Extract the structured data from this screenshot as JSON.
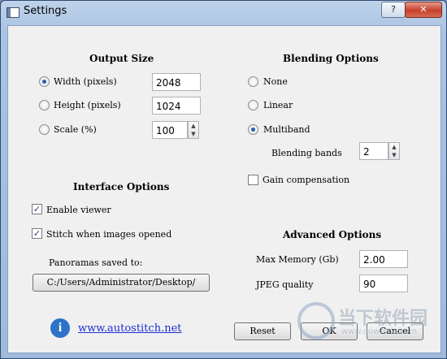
{
  "window": {
    "title": "Settings",
    "help_label": "?",
    "close_label": "✕"
  },
  "output_size": {
    "heading": "Output Size",
    "options": [
      {
        "label": "Width (pixels)",
        "value": "2048",
        "selected": true
      },
      {
        "label": "Height (pixels)",
        "value": "1024",
        "selected": false
      },
      {
        "label": "Scale (%)",
        "value": "100",
        "selected": false
      }
    ]
  },
  "blending": {
    "heading": "Blending Options",
    "options": [
      {
        "label": "None",
        "selected": false
      },
      {
        "label": "Linear",
        "selected": false
      },
      {
        "label": "Multiband",
        "selected": true
      }
    ],
    "bands_label": "Blending bands",
    "bands_value": "2",
    "gain_label": "Gain compensation",
    "gain_checked": false
  },
  "interface": {
    "heading": "Interface Options",
    "enable_viewer_label": "Enable viewer",
    "enable_viewer_checked": true,
    "stitch_label": "Stitch when images opened",
    "stitch_checked": true,
    "saved_to_label": "Panoramas saved to:",
    "path_button": "C:/Users/Administrator/Desktop/"
  },
  "advanced": {
    "heading": "Advanced Options",
    "memory_label": "Max Memory (Gb)",
    "memory_value": "2.00",
    "jpeg_label": "JPEG quality",
    "jpeg_value": "90"
  },
  "footer": {
    "link": "www.autostitch.net",
    "reset": "Reset",
    "ok": "OK",
    "cancel": "Cancel"
  },
  "watermark": {
    "text": "当下软件园",
    "sub": "www.downxia.com"
  },
  "icons": {
    "info": "info-icon",
    "app": "window-app-icon"
  }
}
